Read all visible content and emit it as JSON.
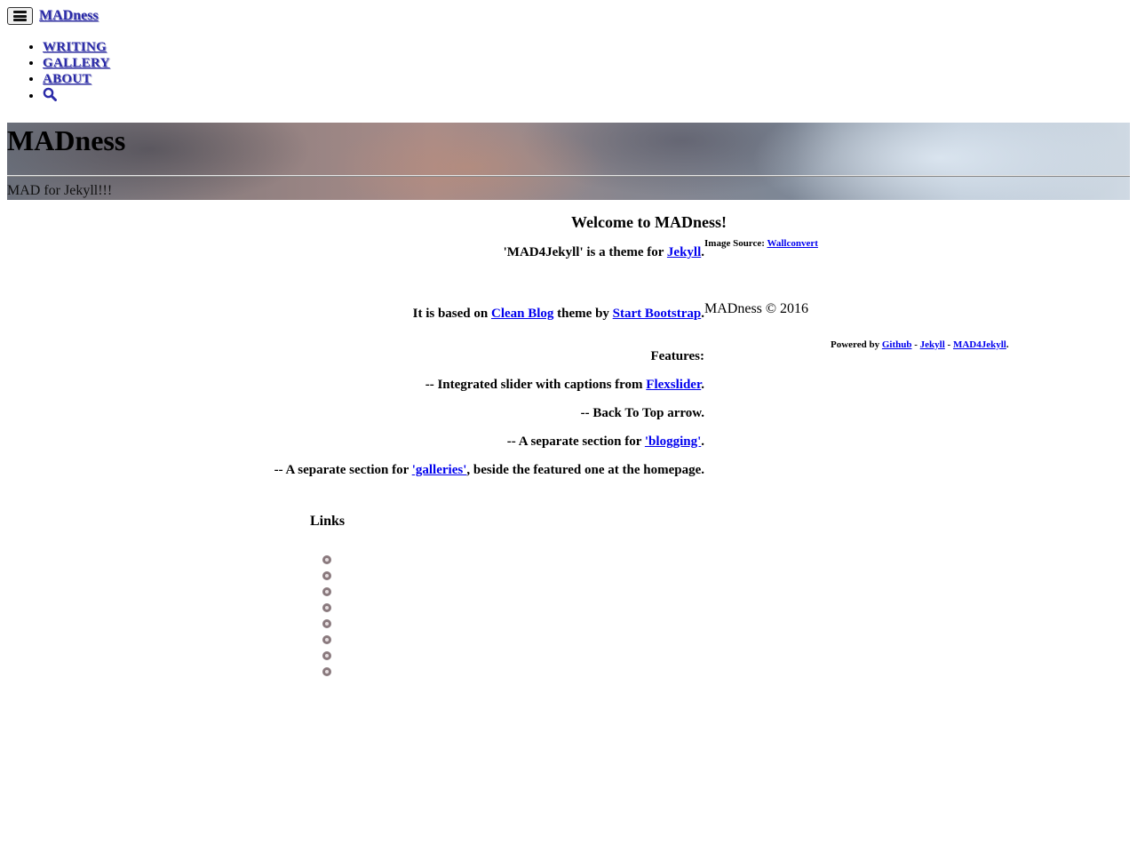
{
  "navbar": {
    "brand": "MADness",
    "items": [
      {
        "label": "WRITING"
      },
      {
        "label": "GALLERY"
      },
      {
        "label": "ABOUT"
      }
    ],
    "search_icon": "search-icon",
    "menu_icon": "hamburger-menu-icon"
  },
  "hero": {
    "title": "MADness",
    "subtitle": "MAD for Jekyll!!!"
  },
  "post": {
    "heading": "Welcome to MADness!",
    "line1_prefix": "'MAD4Jekyll' is a theme for ",
    "line1_link": "Jekyll",
    "line1_suffix": ".",
    "line2_prefix": "It is based on ",
    "line2_link1": "Clean Blog",
    "line2_mid": " theme by ",
    "line2_link2": "Start Bootstrap",
    "line2_suffix": ".",
    "features_label": "Features:",
    "feature1_prefix": "-- Integrated slider with captions from ",
    "feature1_link": "Flexslider",
    "feature1_suffix": ".",
    "feature2": "-- Back To Top arrow.",
    "feature3_prefix": "-- A separate section for ",
    "feature3_link": "'blogging'",
    "feature3_suffix": ".",
    "feature4_prefix": "-- A separate section for ",
    "feature4_link": "'galleries'",
    "feature4_suffix": ", beside the featured one at the homepage."
  },
  "links": {
    "title": "Links",
    "icons": [
      "twitter-icon",
      "facebook-icon",
      "pinterest-icon",
      "instagram-icon",
      "linkedin-icon",
      "flickr-icon",
      "deviantart-icon",
      "email-icon"
    ]
  },
  "footer": {
    "image_source_label": "Image Source: ",
    "image_source_link": "Wallconvert",
    "copyright": "MADness © 2016",
    "powered_prefix": "Powered by ",
    "powered_link1": "Github",
    "sep1": " - ",
    "powered_link2": "Jekyll",
    "sep2": " - ",
    "powered_link3": "MAD4Jekyll",
    "powered_suffix": "."
  },
  "colors": {
    "nav_link": "#2a2aa8",
    "link": "#0000ee",
    "social_icon": "#8a7a7e"
  }
}
